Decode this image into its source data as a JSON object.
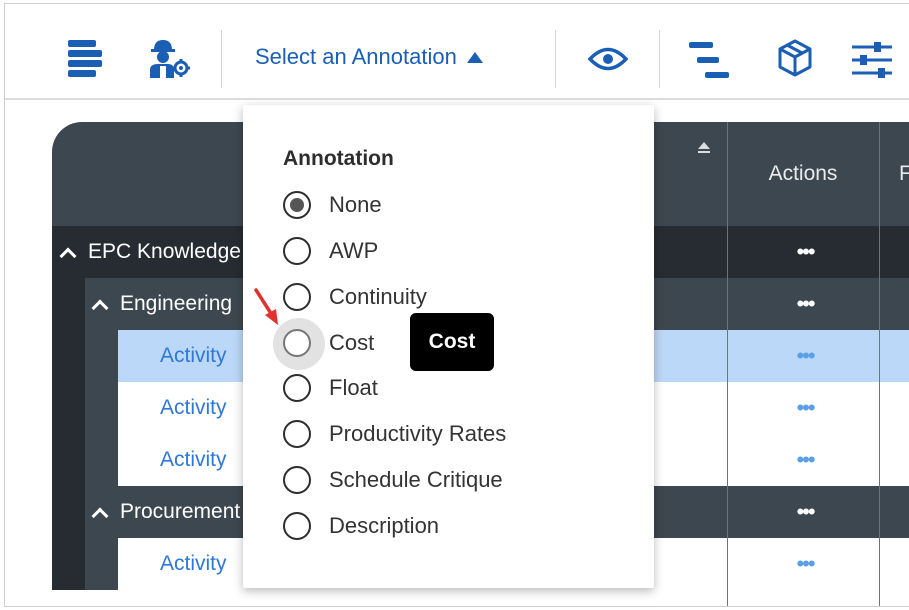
{
  "toolbar": {
    "annotation_select_label": "Select an Annotation",
    "icons": [
      "list-stack-icon",
      "engineer-settings-icon",
      "eye-icon",
      "gantt-bars-icon",
      "cube-icon",
      "sliders-icon"
    ]
  },
  "table": {
    "header": {
      "actions": "Actions",
      "next_col_partial": "F"
    },
    "rows": [
      {
        "level": 0,
        "label": "EPC Knowledge",
        "expanded": true,
        "action": "•••"
      },
      {
        "level": 1,
        "label": "Engineering",
        "expanded": true,
        "action": "•••"
      },
      {
        "level": 2,
        "label": "Activity",
        "selected": true,
        "action": "•••"
      },
      {
        "level": 2,
        "label": "Activity",
        "action": "•••"
      },
      {
        "level": 2,
        "label": "Activity",
        "action": "•••"
      },
      {
        "level": 1,
        "label": "Procurement",
        "expanded": true,
        "action": "•••"
      },
      {
        "level": 2,
        "label": "Activity",
        "action": "•••"
      }
    ]
  },
  "dropdown": {
    "title": "Annotation",
    "options": [
      {
        "label": "None",
        "checked": true
      },
      {
        "label": "AWP",
        "checked": false
      },
      {
        "label": "Continuity",
        "checked": false
      },
      {
        "label": "Cost",
        "checked": false,
        "hovered": true
      },
      {
        "label": "Float",
        "checked": false
      },
      {
        "label": "Productivity Rates",
        "checked": false
      },
      {
        "label": "Schedule Critique",
        "checked": false
      },
      {
        "label": "Description",
        "checked": false
      }
    ]
  },
  "tooltip": {
    "text": "Cost"
  },
  "colors": {
    "accent": "#1a5fb4",
    "header_dark": "#262c31",
    "header": "#3d474f",
    "row_selected": "#bcd8f8",
    "link": "#2f78d6",
    "annotation_arrow": "#e0332f"
  }
}
